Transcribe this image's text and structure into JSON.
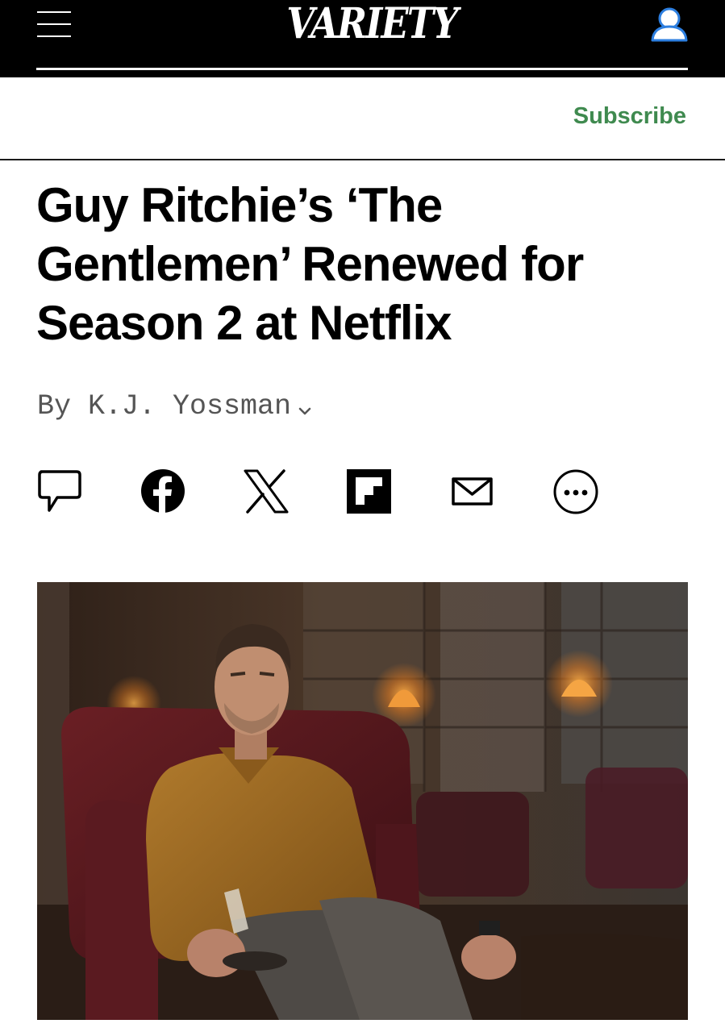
{
  "header": {
    "logo_text": "VARIETY",
    "menu_icon": "hamburger-icon",
    "account_icon": "user-icon",
    "subscribe_label": "Subscribe"
  },
  "article": {
    "headline": "Guy Ritchie’s ‘The Gentlemen’ Renewed for Season 2 at Netflix",
    "byline": "By K.J. Yossman",
    "share_icons": [
      "comment-icon",
      "facebook-icon",
      "x-icon",
      "flipboard-icon",
      "email-icon",
      "more-icon"
    ]
  },
  "colors": {
    "header_bg": "#000000",
    "subscribe": "#3f8a4f",
    "byline": "#555555",
    "text": "#000000"
  }
}
